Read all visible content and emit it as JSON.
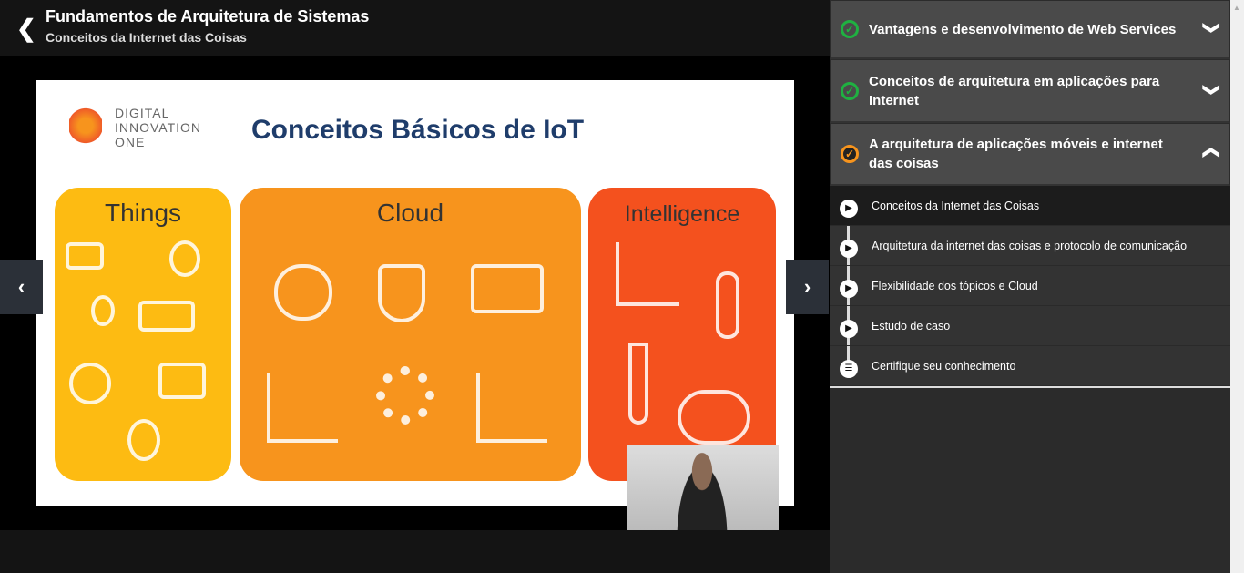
{
  "header": {
    "back_icon": "chevron-left-icon",
    "title": "Fundamentos de Arquitetura de Sistemas",
    "subtitle": "Conceitos da Internet das Coisas"
  },
  "slide": {
    "logo_text": "DIGITAL INNOVATION ONE",
    "title": "Conceitos Básicos de IoT",
    "panels": [
      "Things",
      "Cloud",
      "Intelligence"
    ]
  },
  "sidebar": {
    "sections": [
      {
        "title": "Vantagens e desenvolvimento de Web Services",
        "status": "completed",
        "expanded": false
      },
      {
        "title": "Conceitos de arquitetura em aplicações para Internet",
        "status": "completed",
        "expanded": false
      },
      {
        "title": "A arquitetura de aplicações móveis e internet das coisas",
        "status": "in-progress",
        "expanded": true
      }
    ],
    "lessons": [
      {
        "title": "Conceitos da Internet das Coisas",
        "icon": "play-icon",
        "active": true
      },
      {
        "title": "Arquitetura da internet das coisas e protocolo de comunicação",
        "icon": "play-icon"
      },
      {
        "title": "Flexibilidade dos tópicos e Cloud",
        "icon": "play-icon"
      },
      {
        "title": "Estudo de caso",
        "icon": "play-icon"
      },
      {
        "title": "Certifique seu conhecimento",
        "icon": "list-icon"
      }
    ]
  },
  "colors": {
    "completed": "#1fb141",
    "in_progress": "#f7941d"
  }
}
